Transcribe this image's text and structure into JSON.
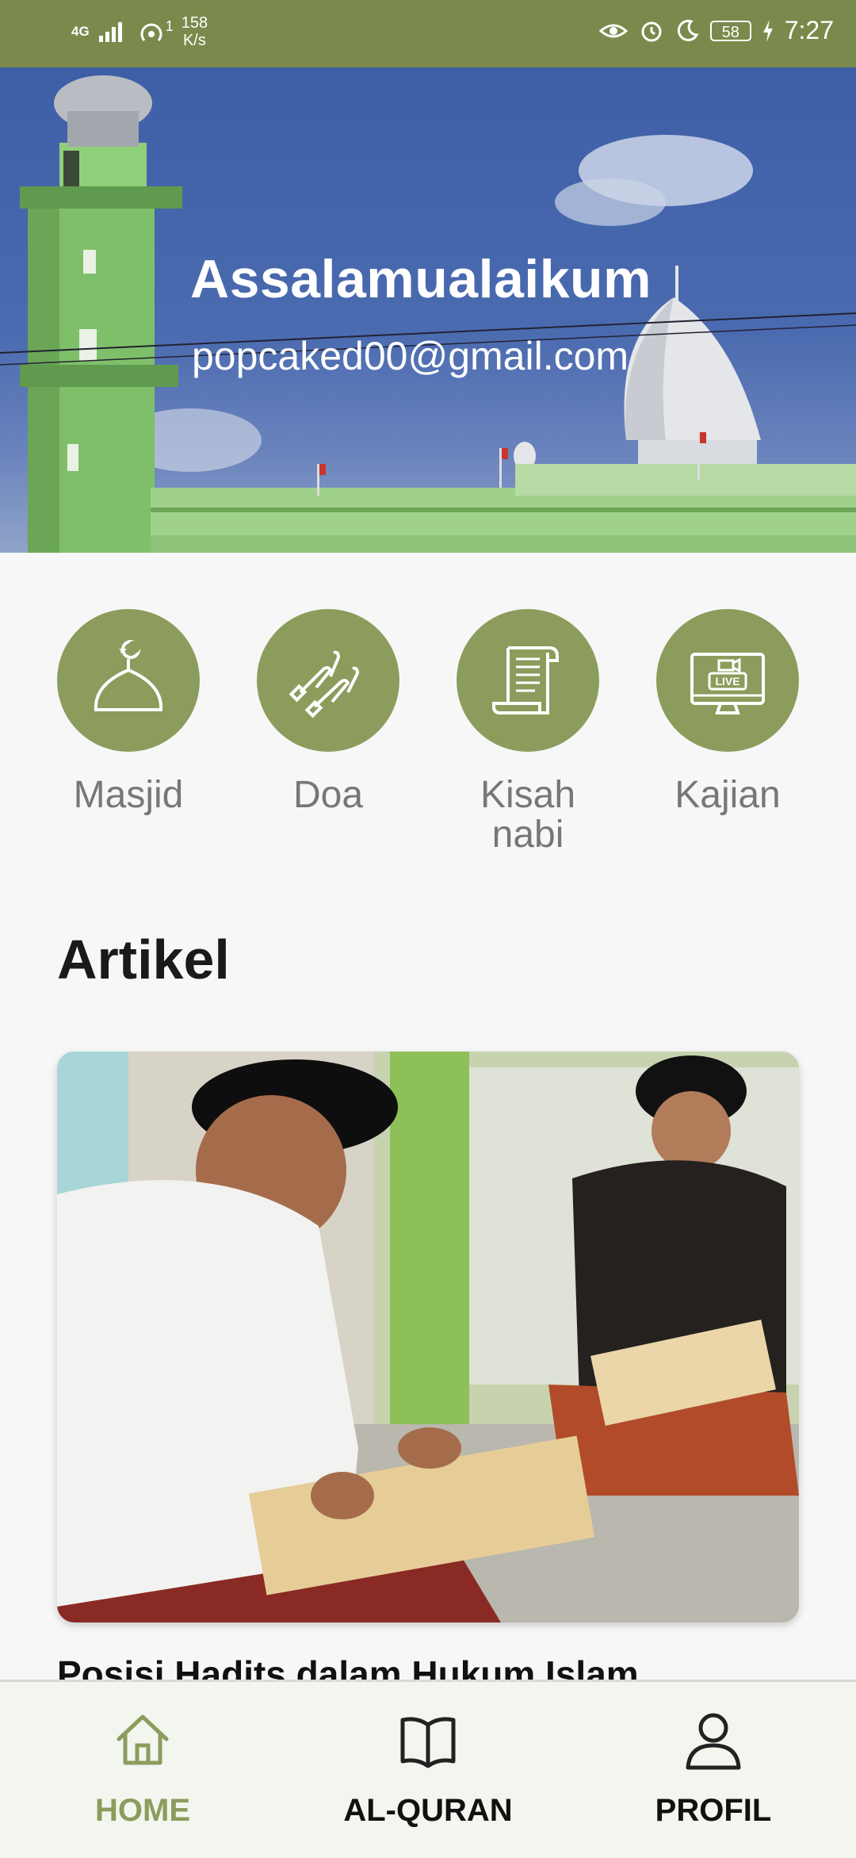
{
  "status_bar": {
    "network": "4G",
    "hotspot_count": "1",
    "speed_value": "158",
    "speed_unit": "K/s",
    "battery": "58",
    "time": "7:27",
    "icons": [
      "signal-icon",
      "hotspot-icon",
      "eye-icon",
      "alarm-icon",
      "moon-icon",
      "battery-icon",
      "charging-icon"
    ]
  },
  "hero": {
    "greeting": "Assalamualaikum",
    "email": "popcaked00@gmail.com"
  },
  "menu": {
    "items": [
      {
        "label": "Masjid",
        "icon": "mosque-dome-icon"
      },
      {
        "label": "Doa",
        "icon": "praying-hands-icon"
      },
      {
        "label": "Kisah nabi",
        "icon": "scroll-icon"
      },
      {
        "label": "Kajian",
        "icon": "live-monitor-icon"
      }
    ]
  },
  "articles": {
    "section_title": "Artikel",
    "items": [
      {
        "title": "Posisi Hadits dalam Hukum Islam"
      }
    ]
  },
  "bottom_nav": {
    "items": [
      {
        "label": "HOME",
        "icon": "home-icon",
        "active": true
      },
      {
        "label": "AL-QURAN",
        "icon": "book-icon",
        "active": false
      },
      {
        "label": "PROFIL",
        "icon": "user-icon",
        "active": false
      }
    ]
  },
  "colors": {
    "accent": "#8c9c5c",
    "status_bar": "#7a8a4c"
  }
}
